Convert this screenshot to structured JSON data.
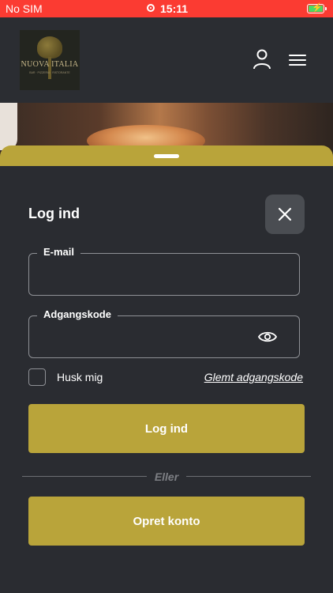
{
  "status_bar": {
    "carrier": "No SIM",
    "time": "15:11"
  },
  "header": {
    "logo_text": "NUOVA ITALIA",
    "logo_subtext": "BAR · PIZZERIA · RISTORANTE",
    "icons": [
      "user-icon",
      "menu-icon"
    ]
  },
  "login": {
    "title": "Log ind",
    "email_label": "E-mail",
    "email_value": "",
    "password_label": "Adgangskode",
    "password_value": "",
    "remember_label": "Husk mig",
    "remember_checked": false,
    "forgot_label": "Glemt adgangskode",
    "login_button": "Log ind",
    "divider_text": "Eller",
    "create_button": "Opret konto"
  },
  "colors": {
    "accent": "#b9a43a",
    "status_bar": "#fb3b32",
    "background": "#2a2c31"
  }
}
